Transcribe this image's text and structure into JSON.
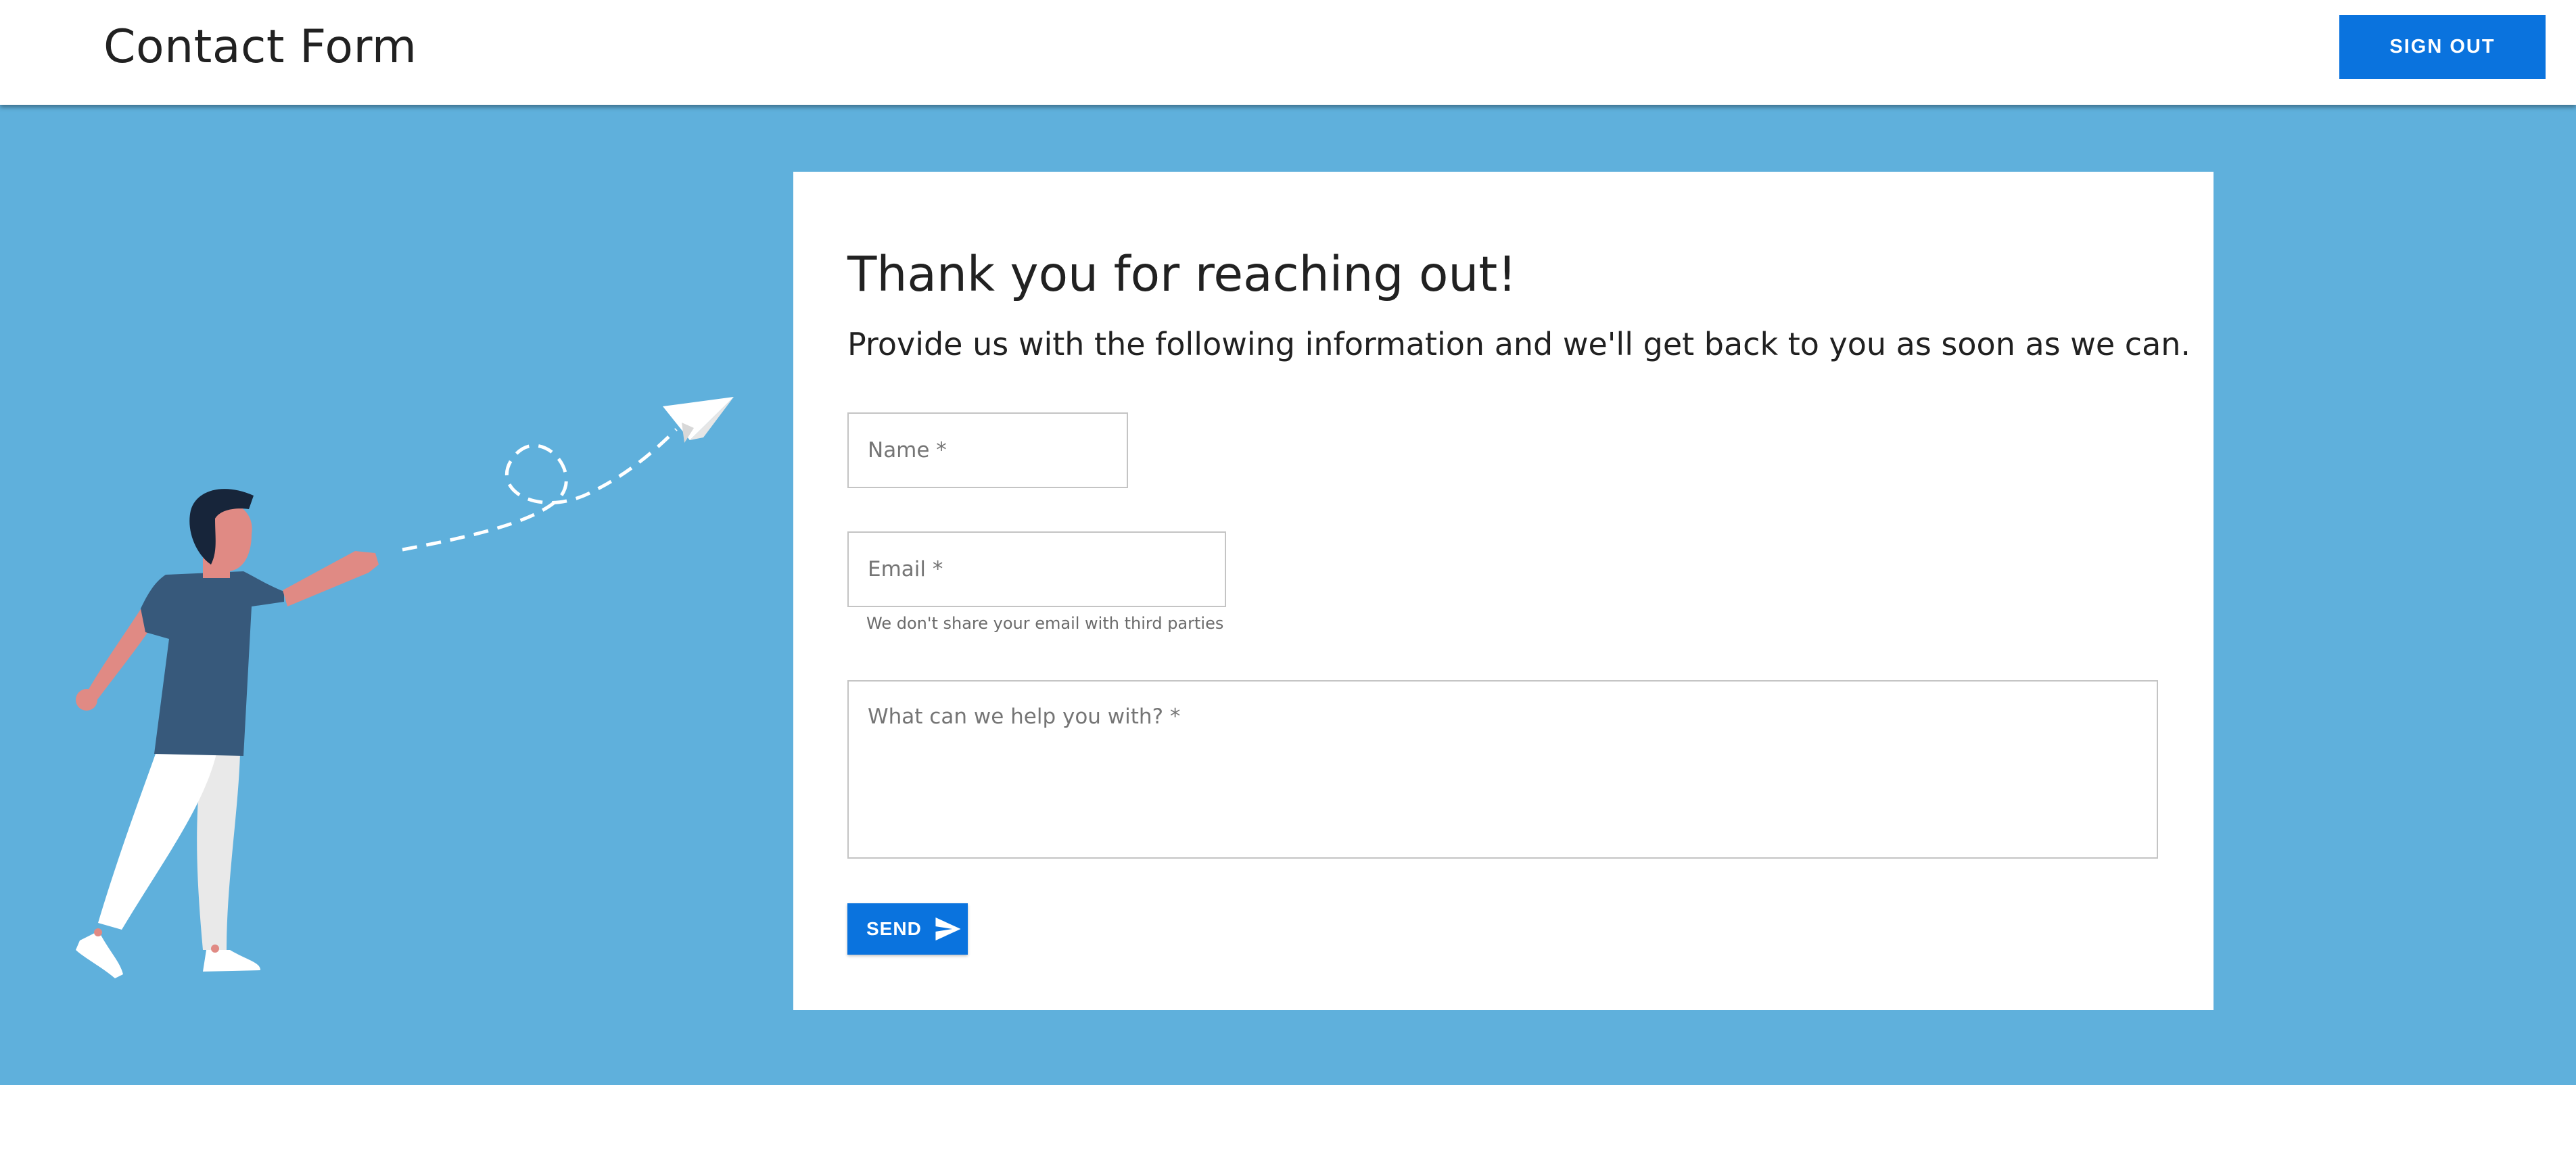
{
  "header": {
    "title": "Contact Form",
    "signout_label": "SIGN OUT"
  },
  "card": {
    "title": "Thank you for reaching out!",
    "subtitle": "Provide us with the following information and we'll get back to you as soon as we can."
  },
  "form": {
    "name_placeholder": "Name *",
    "email_placeholder": "Email *",
    "email_helper": "We don't share your email with third parties",
    "message_placeholder": "What can we help you with? *",
    "send_label": "SEND"
  },
  "colors": {
    "primary": "#0a73de",
    "hero_background": "#5fb0dc",
    "card_background": "#ffffff"
  },
  "icons": {
    "send": "paper-plane-icon"
  }
}
